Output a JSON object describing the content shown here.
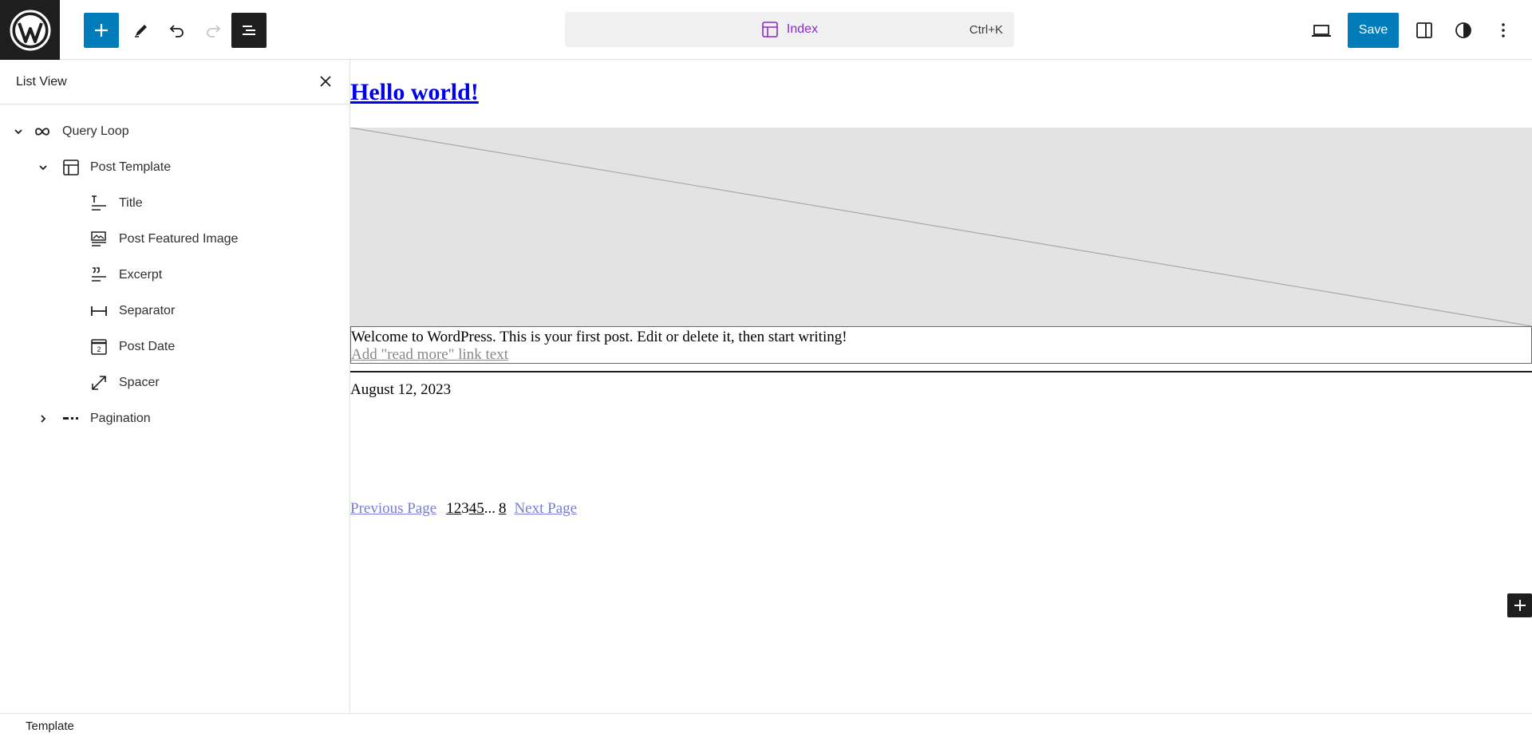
{
  "toolbar": {
    "logo_icon": "wordpress-logo",
    "add_icon": "plus-icon",
    "tools_icon": "pencil-icon",
    "undo_icon": "undo-icon",
    "redo_icon": "redo-icon",
    "list_view_icon": "list-view-icon",
    "command_bar": {
      "icon": "layout-icon",
      "label": "Index",
      "shortcut": "Ctrl+K"
    },
    "view_icon": "desktop-icon",
    "save_label": "Save",
    "settings_icon": "sidebar-icon",
    "styles_icon": "contrast-icon",
    "options_icon": "more-vertical-icon"
  },
  "sidebar": {
    "title": "List View",
    "close_icon": "close-icon",
    "items": [
      {
        "label": "Query Loop",
        "icon": "loop-icon",
        "expanded": true,
        "has_chevron": true,
        "level": 1
      },
      {
        "label": "Post Template",
        "icon": "layout-icon",
        "expanded": true,
        "has_chevron": true,
        "level": 2
      },
      {
        "label": "Title",
        "icon": "title-icon",
        "has_chevron": false,
        "level": 3
      },
      {
        "label": "Post Featured Image",
        "icon": "featured-image-icon",
        "has_chevron": false,
        "level": 3
      },
      {
        "label": "Excerpt",
        "icon": "excerpt-icon",
        "has_chevron": false,
        "level": 3
      },
      {
        "label": "Separator",
        "icon": "separator-icon",
        "has_chevron": false,
        "level": 3
      },
      {
        "label": "Post Date",
        "icon": "calendar-icon",
        "has_chevron": false,
        "level": 3
      },
      {
        "label": "Spacer",
        "icon": "resize-icon",
        "has_chevron": false,
        "level": 3
      },
      {
        "label": "Pagination",
        "icon": "pagination-icon",
        "expanded": false,
        "has_chevron": true,
        "level": 2
      }
    ]
  },
  "canvas": {
    "post_title": "Hello world!",
    "excerpt": "Welcome to WordPress. This is your first post. Edit or delete it, then start writing!",
    "read_more": "Add \"read more\" link text",
    "post_date": "August 12, 2023",
    "pagination": {
      "previous": "Previous Page",
      "pages": [
        "1",
        "2",
        "3",
        "4",
        "5"
      ],
      "dots": "...",
      "last": "8",
      "next": "Next Page"
    },
    "add_block_icon": "plus-icon"
  },
  "footer": {
    "breadcrumb": "Template"
  },
  "colors": {
    "accent": "#007cba",
    "command_text": "#8a2cc6",
    "dark": "#1e1e1e",
    "selection": "#3373bf"
  }
}
